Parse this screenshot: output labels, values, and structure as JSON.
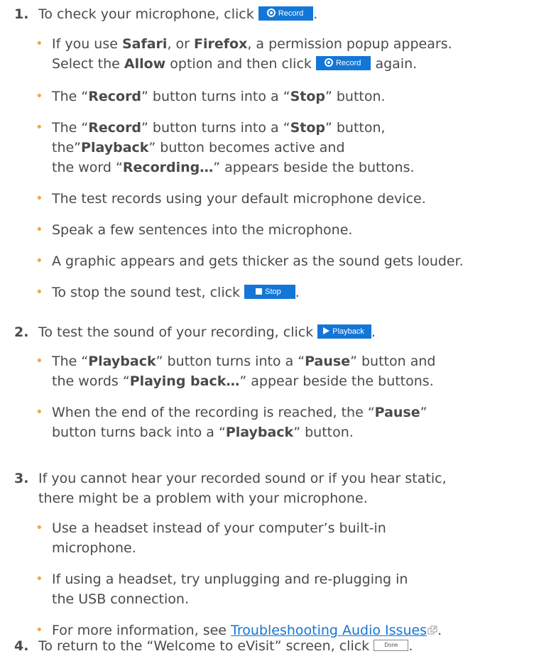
{
  "steps": [
    {
      "number": "1.",
      "intro_prefix": "To check your microphone, click",
      "intro_suffix": ".",
      "bullets": {
        "b1": {
          "line1_pre": "If you use",
          "line1_bold1": "Safari",
          "line1_mid": ", or",
          "line1_bold2": "Firefox",
          "line1_post": ", a permission popup appears.",
          "line2_pre": "Select the",
          "line2_bold": "Allow",
          "line2_mid": "option and then click",
          "line2_post": "again."
        },
        "b2": {
          "q1": "The “",
          "bold1": "Record",
          "mid": "” button turns into a “",
          "bold2": "Stop",
          "end": "” button."
        },
        "b3": {
          "q1": "The “",
          "bold1": "Record",
          "mid": "” button turns into a “",
          "bold2": "Stop",
          "end": "” button,",
          "line2_pre": "the”",
          "line2_bold": "Playback",
          "line2_post": "” button becomes active and",
          "line3_pre": "the word “",
          "line3_bold": "Recording…",
          "line3_post": "” appears beside the buttons."
        },
        "b4": "The test records using your default microphone device.",
        "b5": "Speak a few sentences into the microphone.",
        "b6": "A graphic appears and gets thicker as the sound gets louder.",
        "b7_prefix": "To stop the sound test, click",
        "b7_suffix": "."
      }
    },
    {
      "number": "2.",
      "intro_prefix": "To test the sound of your recording, click",
      "intro_suffix": ".",
      "bullets": {
        "b1": {
          "q1": "The “",
          "bold1": "Playback",
          "mid": "” button turns into a “",
          "bold2": "Pause",
          "end": "” button and",
          "line2_pre": "the words “",
          "line2_bold": "Playing back…",
          "line2_post": "” appear beside the buttons."
        },
        "b2": {
          "pre": "When the end of the recording is reached, the “",
          "bold1": "Pause",
          "post": "”",
          "line2_pre": "button turns back into a “",
          "line2_bold": "Playback",
          "line2_post": "” button."
        }
      }
    },
    {
      "number": "3.",
      "intro_line1": "If you cannot hear your recorded sound or if you hear static,",
      "intro_line2": "there might be a problem with your microphone.",
      "bullets": {
        "b1_line1": "Use a headset instead of your computer’s built-in",
        "b1_line2": "microphone.",
        "b2_line1": "If using a headset, try unplugging and re-plugging in",
        "b2_line2": "the USB connection.",
        "b3_prefix": "For more information, see",
        "b3_link": "Troubleshooting Audio Issues",
        "b3_suffix": "."
      }
    },
    {
      "number": "4.",
      "intro_prefix": "To return to the “Welcome to eVisit” screen, click",
      "intro_suffix": "."
    }
  ],
  "buttons": {
    "record": "Record",
    "stop": "Stop",
    "playback": "Playback",
    "done": "Done"
  },
  "bullet_char": "•",
  "colors": {
    "button_blue": "#1476d6",
    "bullet_orange": "#f0a84c",
    "text": "#4a4a4a",
    "link": "#1476d6"
  }
}
